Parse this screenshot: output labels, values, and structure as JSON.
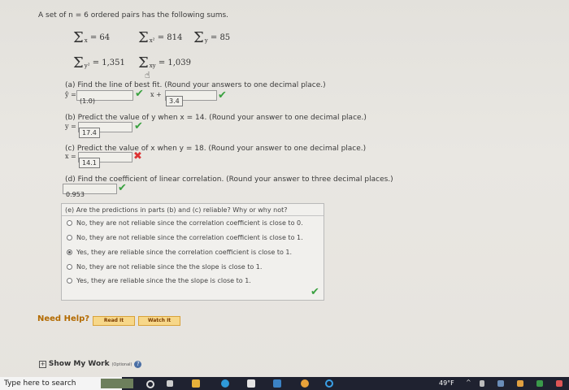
{
  "problem": {
    "intro": "A set of n = 6 ordered pairs has the following sums.",
    "sums": [
      {
        "sub": "x",
        "value": "= 64"
      },
      {
        "sub": "x²",
        "value": "= 814"
      },
      {
        "sub": "y",
        "value": "= 85"
      },
      {
        "sub": "y²",
        "value": "= 1,351"
      },
      {
        "sub": "xy",
        "value": "= 1,039"
      }
    ]
  },
  "part_a": {
    "question": "(a) Find the line of best fit. (Round your answers to one decimal place.)",
    "lhs": "ŷ =",
    "slope": "(1.0)",
    "mid": "x +",
    "intercept": "3.4"
  },
  "part_b": {
    "question": "(b) Predict the value of y when x = 14. (Round your answer to one decimal place.)",
    "lhs": "y =",
    "answer": "17.4"
  },
  "part_c": {
    "question": "(c) Predict the value of x when y = 18. (Round your answer to one decimal place.)",
    "lhs": "x =",
    "answer": "14.1"
  },
  "part_d": {
    "question": "(d) Find the coefficient of linear correlation. (Round your answer to three decimal places.)",
    "answer": "0.953"
  },
  "part_e": {
    "question": "(e) Are the predictions in parts (b) and (c) reliable? Why or why not?",
    "options": [
      "No, they are not reliable since the correlation coefficient is close to 0.",
      "No, they are not reliable since the correlation coefficient is close to 1.",
      "Yes, they are reliable since the correlation coefficient is close to 1.",
      "No, they are not reliable since the the slope is close to 1.",
      "Yes, they are reliable since the the slope is close to 1."
    ],
    "selected_index": 2
  },
  "help": {
    "label": "Need Help?",
    "read_button": "Read It",
    "watch_button": "Watch It"
  },
  "show_work": {
    "label": "Show My Work",
    "optional": "(Optional)"
  },
  "taskbar": {
    "search_placeholder": "Type here to search",
    "temperature": "49°F"
  }
}
